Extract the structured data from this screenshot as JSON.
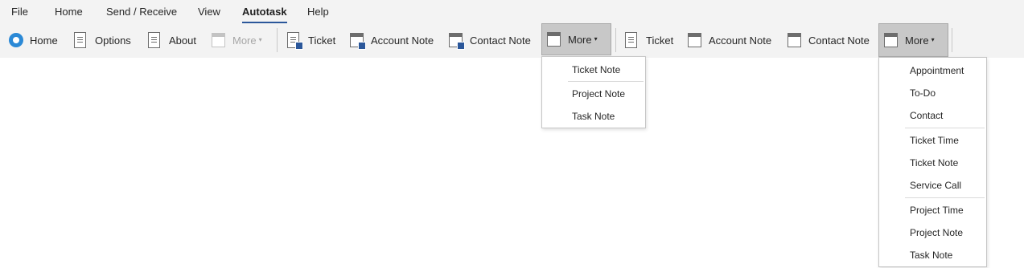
{
  "menu": {
    "tabs": [
      {
        "label": "File"
      },
      {
        "label": "Home"
      },
      {
        "label": "Send / Receive"
      },
      {
        "label": "View"
      },
      {
        "label": "Autotask"
      },
      {
        "label": "Help"
      }
    ],
    "active_tab": "Autotask"
  },
  "ribbon": {
    "home": {
      "label": "Home",
      "icon": "autotask-logo-icon"
    },
    "options": {
      "label": "Options",
      "icon": "list-icon"
    },
    "about": {
      "label": "About",
      "icon": "document-icon"
    },
    "more_disabled": {
      "label": "More",
      "icon": "calendar-icon"
    },
    "group1": {
      "ticket": {
        "label": "Ticket",
        "icon": "ticket-icon"
      },
      "account_note": {
        "label": "Account Note",
        "icon": "account-note-icon"
      },
      "contact_note": {
        "label": "Contact Note",
        "icon": "contact-note-icon"
      },
      "more": {
        "label": "More",
        "icon": "calendar-icon"
      }
    },
    "group2": {
      "ticket": {
        "label": "Ticket",
        "icon": "ticket-icon"
      },
      "account_note": {
        "label": "Account Note",
        "icon": "account-note-icon"
      },
      "contact_note": {
        "label": "Contact Note",
        "icon": "contact-note-icon"
      },
      "more": {
        "label": "More",
        "icon": "calendar-icon"
      }
    }
  },
  "dropdown1": {
    "items": [
      "Ticket Note",
      "Project Note",
      "Task Note"
    ]
  },
  "dropdown2": {
    "items": [
      "Appointment",
      "To-Do",
      "Contact",
      "Ticket Time",
      "Ticket Note",
      "Service Call",
      "Project Time",
      "Project Note",
      "Task Note"
    ]
  },
  "colors": {
    "ribbon_bg": "#f3f3f3",
    "accent": "#2b579a",
    "pressed_bg": "#c8c8c8"
  }
}
